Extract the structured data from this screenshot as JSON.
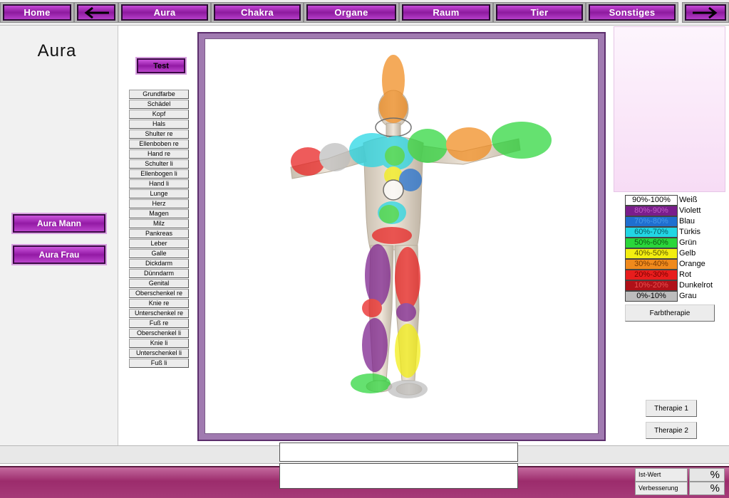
{
  "nav": {
    "home": "Home",
    "back_icon": "arrow-left-icon",
    "aura": "Aura",
    "chakra": "Chakra",
    "organe": "Organe",
    "raum": "Raum",
    "tier": "Tier",
    "sonstiges": "Sonstiges",
    "forward_icon": "arrow-right-icon"
  },
  "page_title": "Aura",
  "buttons": {
    "test": "Test",
    "aura_mann": "Aura Mann",
    "aura_frau": "Aura Frau",
    "farbtherapie": "Farbtherapie",
    "therapie1": "Therapie 1",
    "therapie2": "Therapie 2"
  },
  "body_parts": [
    "Grundfarbe",
    "Schädel",
    "Kopf",
    "Hals",
    "Shulter re",
    "Ellenboben re",
    "Hand re",
    "Schulter li",
    "Ellenbogen li",
    "Hand li",
    "Lunge",
    "Herz",
    "Magen",
    "Milz",
    "Pankreas",
    "Leber",
    "Galle",
    "Dickdarm",
    "Dünndarm",
    "Genital",
    "Oberschenkel re",
    "Knie re",
    "Unterschenkel re",
    "Fuß re",
    "Oberschenkel li",
    "Knie li",
    "Unterschenkel li",
    "Fuß li"
  ],
  "legend": [
    {
      "range": "90%-100%",
      "name": "Weiß",
      "color": "#ffffff",
      "text": "#000000"
    },
    {
      "range": "80%-90%",
      "name": "Violett",
      "color": "#7a1d8c",
      "text": "#c060c8"
    },
    {
      "range": "70%-80%",
      "name": "Blau",
      "color": "#1f6fd0",
      "text": "#4a9ae8"
    },
    {
      "range": "60%-70%",
      "name": "Türkis",
      "color": "#22d6e4",
      "text": "#0a5a66"
    },
    {
      "range": "50%-60%",
      "name": "Grün",
      "color": "#2ad63a",
      "text": "#0b5a10"
    },
    {
      "range": "40%-50%",
      "name": "Gelb",
      "color": "#f3ee10",
      "text": "#5a5400"
    },
    {
      "range": "30%-40%",
      "name": "Orange",
      "color": "#f08a1c",
      "text": "#7a3a00"
    },
    {
      "range": "20%-30%",
      "name": "Rot",
      "color": "#e81d1d",
      "text": "#7a0000"
    },
    {
      "range": "10%-20%",
      "name": "Dunkelrot",
      "color": "#b01018",
      "text": "#ea5050"
    },
    {
      "range": "0%-10%",
      "name": "Grau",
      "color": "#bdbdbd",
      "text": "#000000"
    }
  ],
  "values": {
    "ist_label": "Ist-Wert",
    "ist_value": "%",
    "verb_label": "Verbesserung",
    "verb_value": "%"
  },
  "colors": {
    "brand_purple": "#931aa5",
    "bottom_bar": "#9c2c6c"
  }
}
